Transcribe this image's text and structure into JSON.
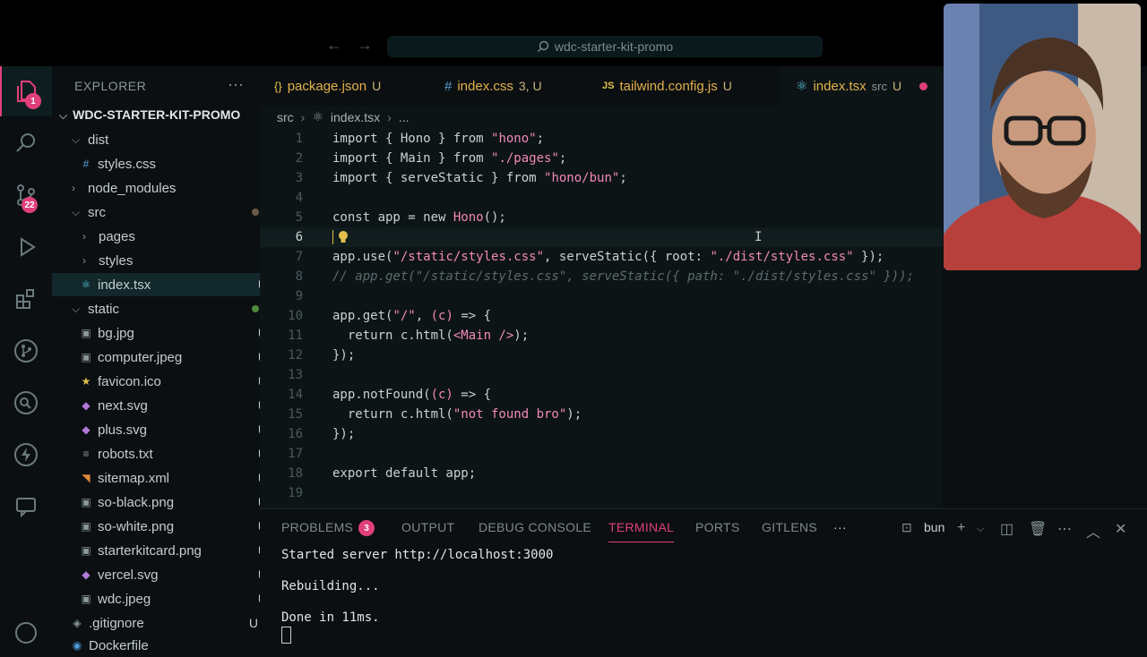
{
  "titlebar": {
    "search_text": "wdc-starter-kit-promo"
  },
  "activity": {
    "explorer_badge": "1",
    "scm_badge": "22"
  },
  "sidebar": {
    "title": "EXPLORER",
    "more": "···",
    "root": "WDC-STARTER-KIT-PROMO",
    "items": [
      {
        "label": "dist",
        "status": ""
      },
      {
        "label": "styles.css",
        "status": ""
      },
      {
        "label": "node_modules",
        "status": ""
      },
      {
        "label": "src",
        "status": ""
      },
      {
        "label": "pages",
        "status": ""
      },
      {
        "label": "styles",
        "status": ""
      },
      {
        "label": "index.tsx",
        "status": "U"
      },
      {
        "label": "static",
        "status": ""
      },
      {
        "label": "bg.jpg",
        "status": "U"
      },
      {
        "label": "computer.jpeg",
        "status": "U"
      },
      {
        "label": "favicon.ico",
        "status": "U"
      },
      {
        "label": "next.svg",
        "status": "U"
      },
      {
        "label": "plus.svg",
        "status": "U"
      },
      {
        "label": "robots.txt",
        "status": "U"
      },
      {
        "label": "sitemap.xml",
        "status": "U"
      },
      {
        "label": "so-black.png",
        "status": "U"
      },
      {
        "label": "so-white.png",
        "status": "U"
      },
      {
        "label": "starterkitcard.png",
        "status": "U"
      },
      {
        "label": "vercel.svg",
        "status": "U"
      },
      {
        "label": "wdc.jpeg",
        "status": "U"
      },
      {
        "label": ".gitignore",
        "status": "U"
      },
      {
        "label": "Dockerfile",
        "status": ""
      }
    ]
  },
  "tabs": [
    {
      "icon": "{}",
      "label": "package.json",
      "status": "U"
    },
    {
      "icon": "#",
      "label": "index.css",
      "status": "3, U"
    },
    {
      "icon": "JS",
      "label": "tailwind.config.js",
      "status": "U"
    },
    {
      "icon": "⚛",
      "label": "index.tsx",
      "detail": "src",
      "status": "U"
    }
  ],
  "breadcrumb": {
    "folder": "src",
    "file": "index.tsx",
    "more": "..."
  },
  "code": {
    "line_numbers": [
      "1",
      "2",
      "3",
      "4",
      "5",
      "6",
      "7",
      "8",
      "9",
      "10",
      "11",
      "12",
      "13",
      "14",
      "15",
      "16",
      "17",
      "18",
      "19"
    ],
    "l1": {
      "a": "import { Hono } from ",
      "b": "\"hono\"",
      "c": ";"
    },
    "l2": {
      "a": "import { Main } from ",
      "b": "\"./pages\"",
      "c": ";"
    },
    "l3": {
      "a": "import { serveStatic } from ",
      "b": "\"hono/bun\"",
      "c": ";"
    },
    "l5": {
      "a": "const app = new ",
      "b": "Hono",
      "c": "();"
    },
    "l7": {
      "a": "app.use(",
      "b": "\"/static/styles.css\"",
      "c": ", serveStatic({ root: ",
      "d": "\"./dist/styles.css\"",
      "e": " });"
    },
    "l8": "// app.get(\"/static/styles.css\", serveStatic({ path: \"./dist/styles.css\" }));",
    "l10": {
      "a": "app.get(",
      "b": "\"/\"",
      "c": ", ",
      "d": "(c)",
      "e": " => {"
    },
    "l11": {
      "a": "  return c.html(",
      "b": "<Main />",
      "c": ");"
    },
    "l12": "});",
    "l14": {
      "a": "app.notFound(",
      "b": "(c)",
      "c": " => {"
    },
    "l15": {
      "a": "  return c.html(",
      "b": "\"not found bro\"",
      "c": ");"
    },
    "l16": "});",
    "l18": "export default app;"
  },
  "panel": {
    "tabs": [
      "PROBLEMS",
      "OUTPUT",
      "DEBUG CONSOLE",
      "TERMINAL",
      "PORTS",
      "GITLENS"
    ],
    "problems_count": "3",
    "more": "···",
    "terminal_name": "bun",
    "terminal_lines": [
      "Started server http://localhost:3000",
      "Rebuilding...",
      "Done in 11ms."
    ]
  },
  "colors": {
    "accent": "#e0407a",
    "modified": "#e3b24c",
    "string": "#f08ab8"
  }
}
